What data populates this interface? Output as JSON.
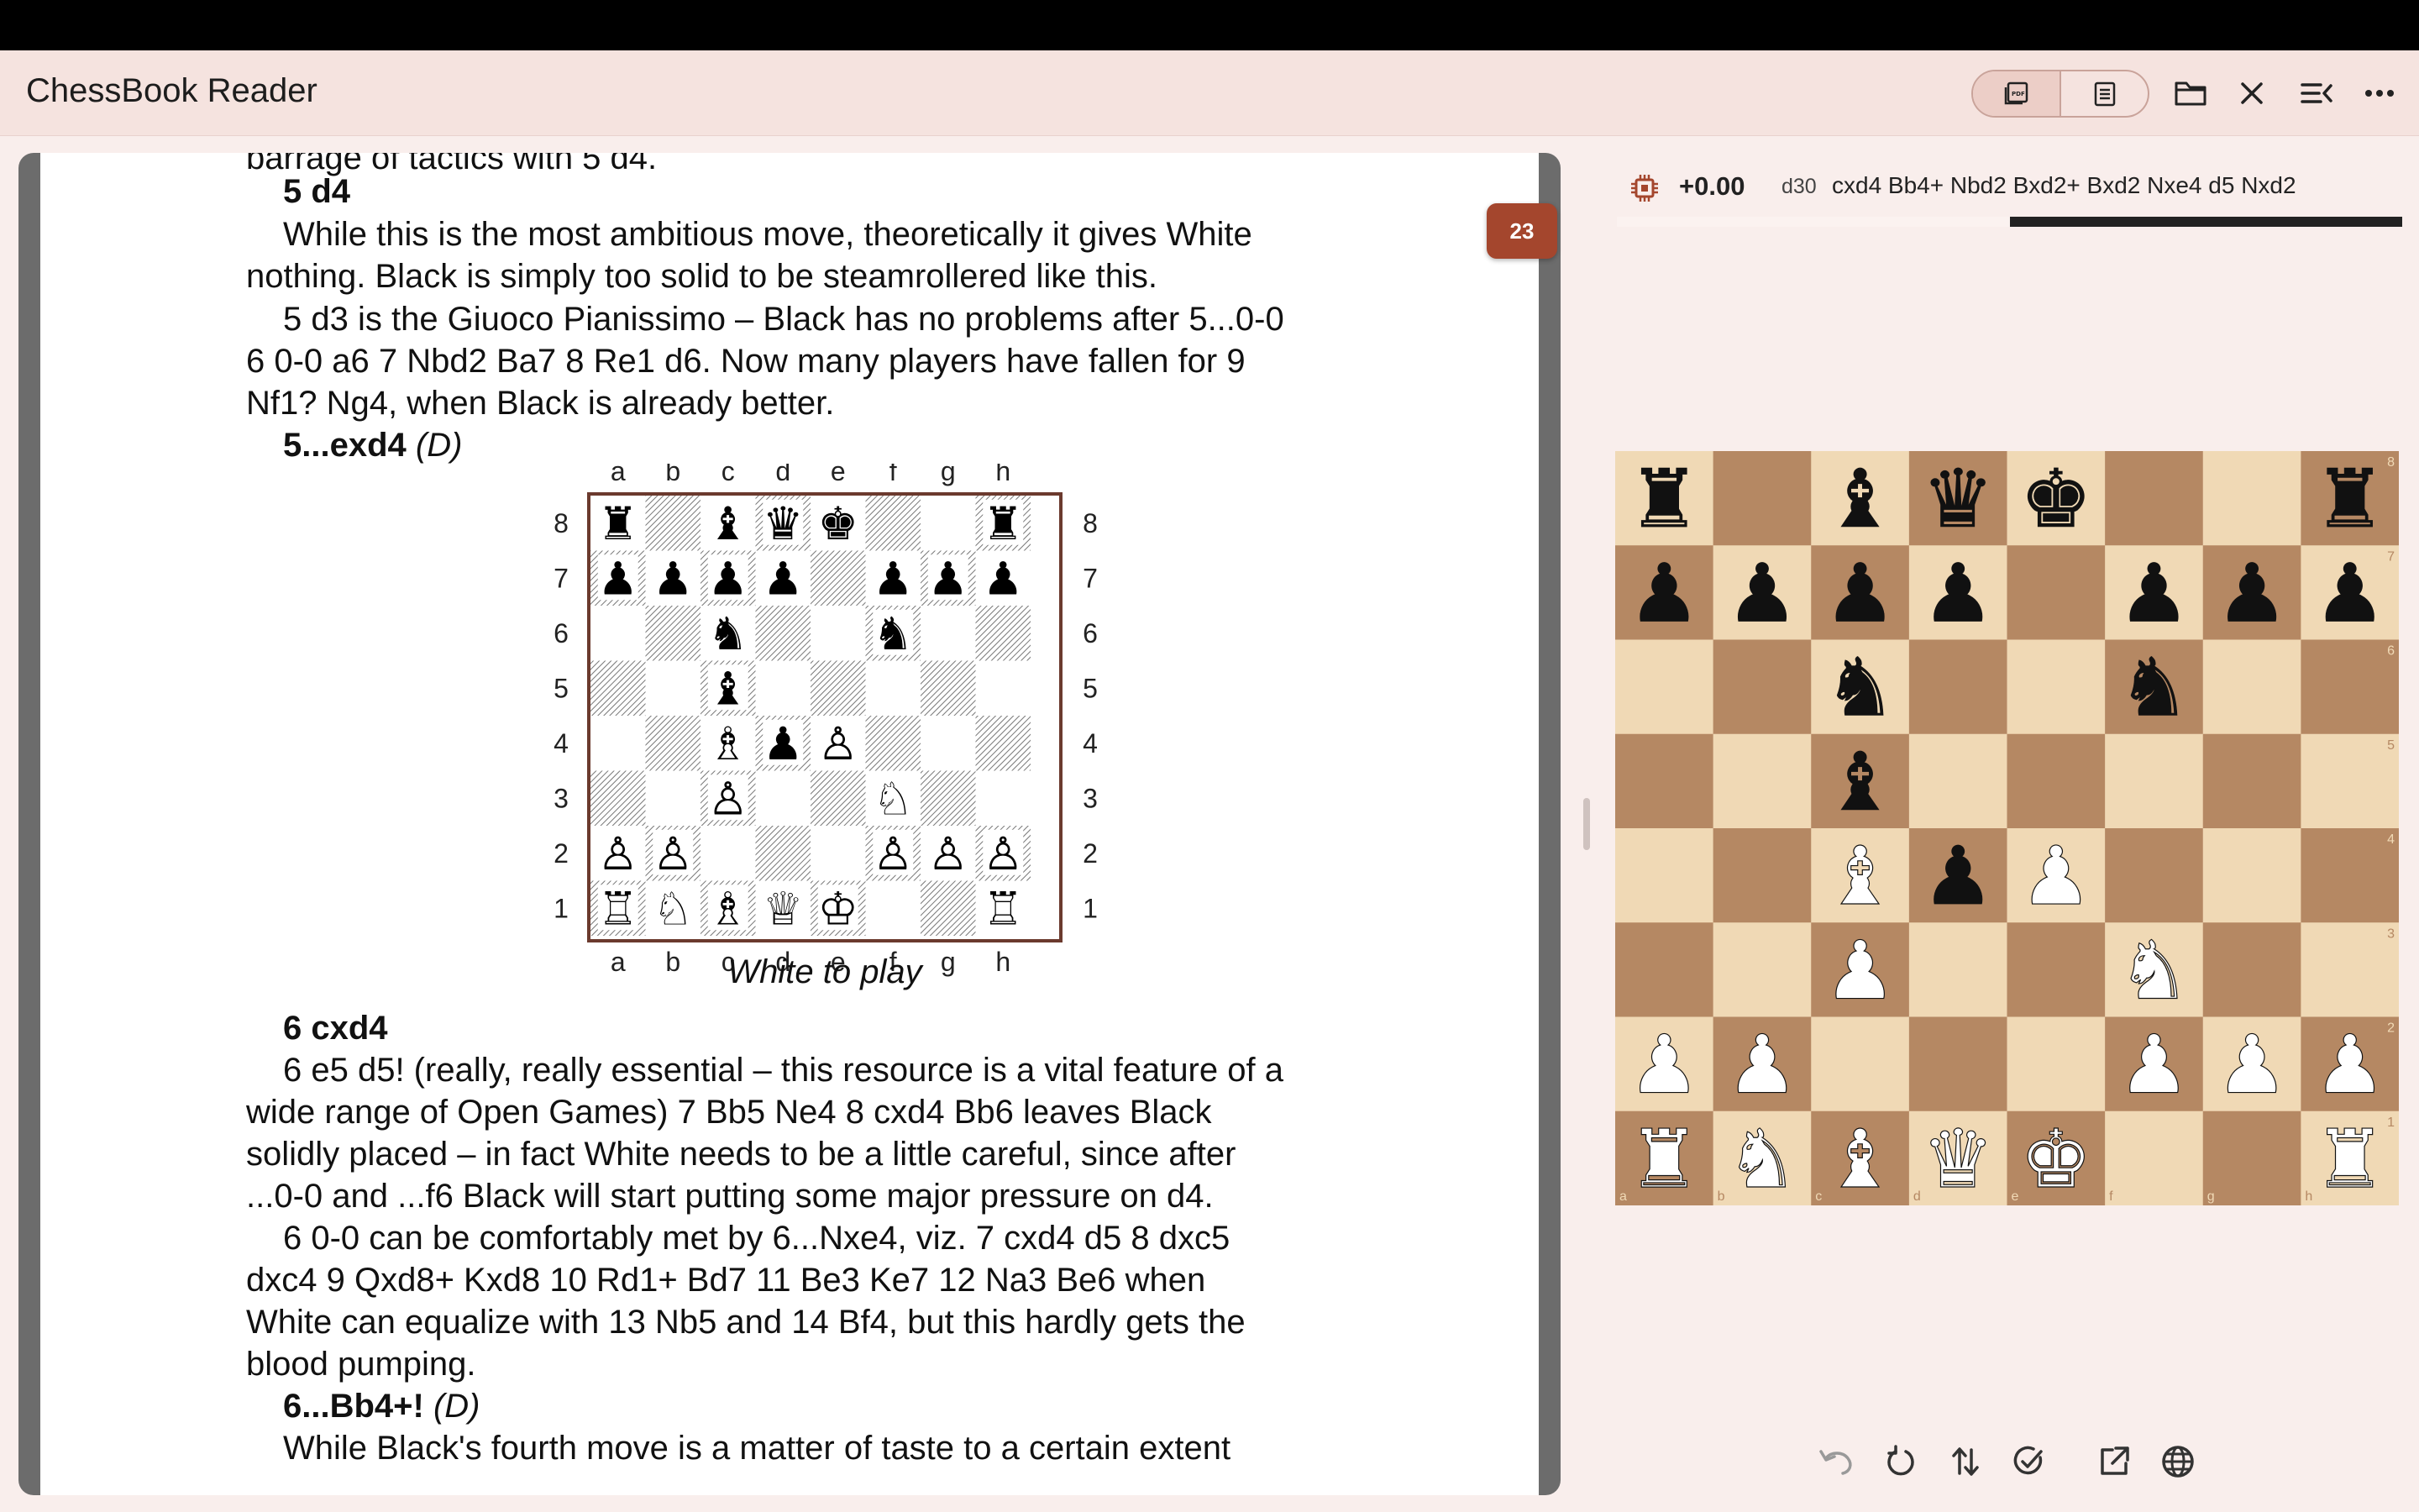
{
  "app": {
    "title": "ChessBook Reader"
  },
  "toolbar": {
    "pdf_icon": "pdf-view-icon",
    "text_icon": "text-view-icon",
    "folder_icon": "folder-icon",
    "close_icon": "close-icon",
    "list_icon": "list-collapse-icon",
    "more_icon": "more-icon"
  },
  "book": {
    "page_number": "23",
    "lines": [
      {
        "text": "barrage of tactics with 5 d4.",
        "bold": false
      },
      {
        "text": "5 d4",
        "bold": true
      },
      {
        "text": "While this is the most ambitious move, theoretically it gives White",
        "bold": false
      },
      {
        "text": "nothing. Black is simply too solid to be steamrollered like this.",
        "bold": false
      },
      {
        "text": "5 d3 is the Giuoco Pianissimo – Black has no problems after 5...0-0",
        "bold": false
      },
      {
        "text": "6 0-0 a6 7 Nbd2 Ba7 8 Re1 d6. Now many players have fallen for 9",
        "bold": false
      },
      {
        "text": "Nf1? Ng4, when Black is already better.",
        "bold": false
      },
      {
        "text": "5...exd4",
        "bold": true,
        "suffix": "(D)"
      },
      {
        "text": "6 cxd4",
        "bold": true
      },
      {
        "text": "6 e5 d5! (really, really essential – this resource is a vital feature of a",
        "bold": false
      },
      {
        "text": "wide range of Open Games) 7 Bb5 Ne4 8 cxd4 Bb6 leaves Black",
        "bold": false
      },
      {
        "text": "solidly placed – in fact White needs to be a little careful, since after",
        "bold": false
      },
      {
        "text": "...0-0 and ...f6 Black will start putting some major pressure on d4.",
        "bold": false
      },
      {
        "text": "6 0-0 can be comfortably met by 6...Nxe4, viz. 7 cxd4 d5 8 dxc5",
        "bold": false
      },
      {
        "text": "dxc4 9 Qxd8+ Kxd8 10 Rd1+ Bd7 11 Be3 Ke7 12 Na3 Be6 when",
        "bold": false
      },
      {
        "text": "White can equalize with 13 Nb5 and 14 Bf4, but this hardly gets the",
        "bold": false
      },
      {
        "text": "blood pumping.",
        "bold": false
      },
      {
        "text": "6...Bb4+!",
        "bold": true,
        "suffix": "(D)"
      },
      {
        "text": "While Black's fourth move is a matter of taste to a certain extent",
        "bold": false
      }
    ],
    "diagram_caption": "White to play",
    "files": [
      "a",
      "b",
      "c",
      "d",
      "e",
      "f",
      "g",
      "h"
    ],
    "ranks": [
      "8",
      "7",
      "6",
      "5",
      "4",
      "3",
      "2",
      "1"
    ]
  },
  "position": {
    "fen_rows": [
      "r1bqk2r",
      "pppp1ppp",
      "2n2n2",
      "2b5",
      "2BpP3",
      "2P2N2",
      "PP3PPP",
      "RNBQK2R"
    ]
  },
  "engine": {
    "icon": "engine-chip-icon",
    "eval": "+0.00",
    "depth": "d30",
    "pv": "cxd4 Bb4+ Nbd2 Bxd2+ Bxd2 Nxe4 d5 Nxd2",
    "white_share": 0.5
  },
  "colors": {
    "light_square": "#f0d9b5",
    "dark_square": "#b58863",
    "accent": "#a4462d"
  },
  "bottom_actions": [
    "undo-icon",
    "reset-icon",
    "flip-board-icon",
    "analysis-icon",
    "share-icon",
    "globe-icon"
  ]
}
